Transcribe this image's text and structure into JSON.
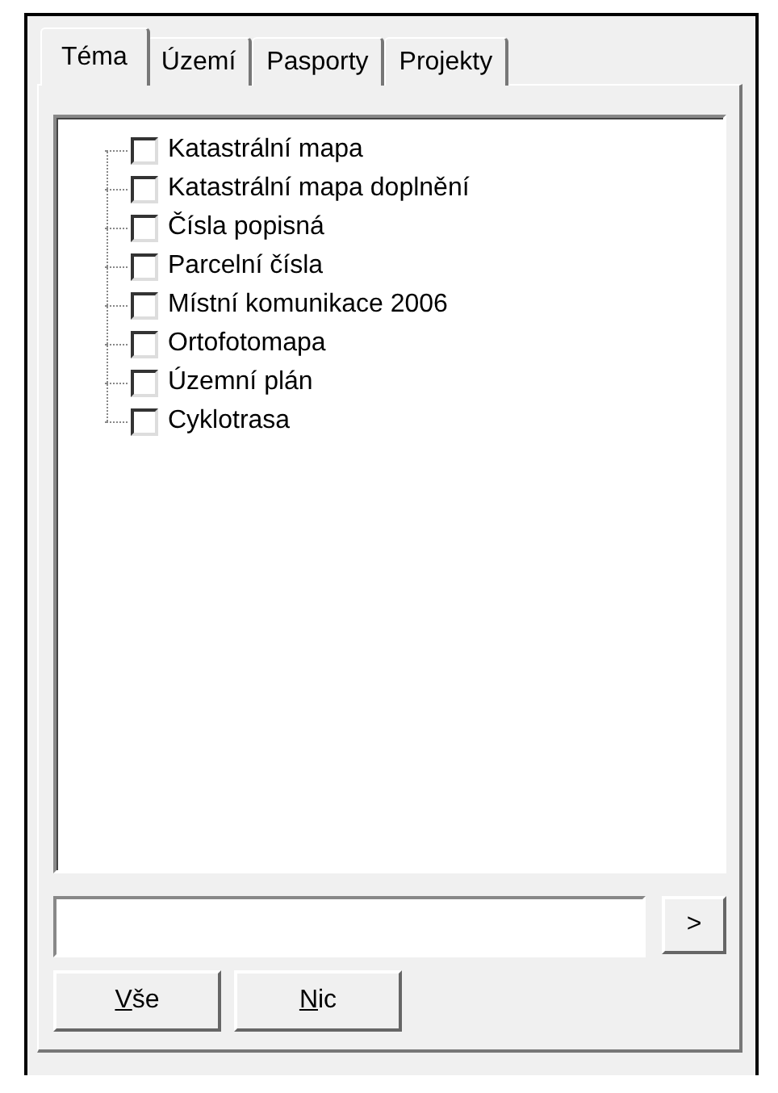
{
  "tabs": [
    {
      "label": "Téma",
      "selected": true
    },
    {
      "label": "Území",
      "selected": false
    },
    {
      "label": "Pasporty",
      "selected": false
    },
    {
      "label": "Projekty",
      "selected": false
    }
  ],
  "tree": {
    "items": [
      {
        "label": "Katastrální mapa",
        "checked": false
      },
      {
        "label": "Katastrální mapa doplnění",
        "checked": false
      },
      {
        "label": "Čísla popisná",
        "checked": false
      },
      {
        "label": "Parcelní čísla",
        "checked": false
      },
      {
        "label": "Místní komunikace 2006",
        "checked": false
      },
      {
        "label": "Ortofotomapa",
        "checked": false
      },
      {
        "label": "Územní plán",
        "checked": false
      },
      {
        "label": "Cyklotrasa",
        "checked": false
      }
    ]
  },
  "search": {
    "go_label": ">"
  },
  "buttons": [
    {
      "label": "Vše",
      "mnemonic_underlined": true
    },
    {
      "label": "Nic",
      "mnemonic_underlined": true
    }
  ]
}
